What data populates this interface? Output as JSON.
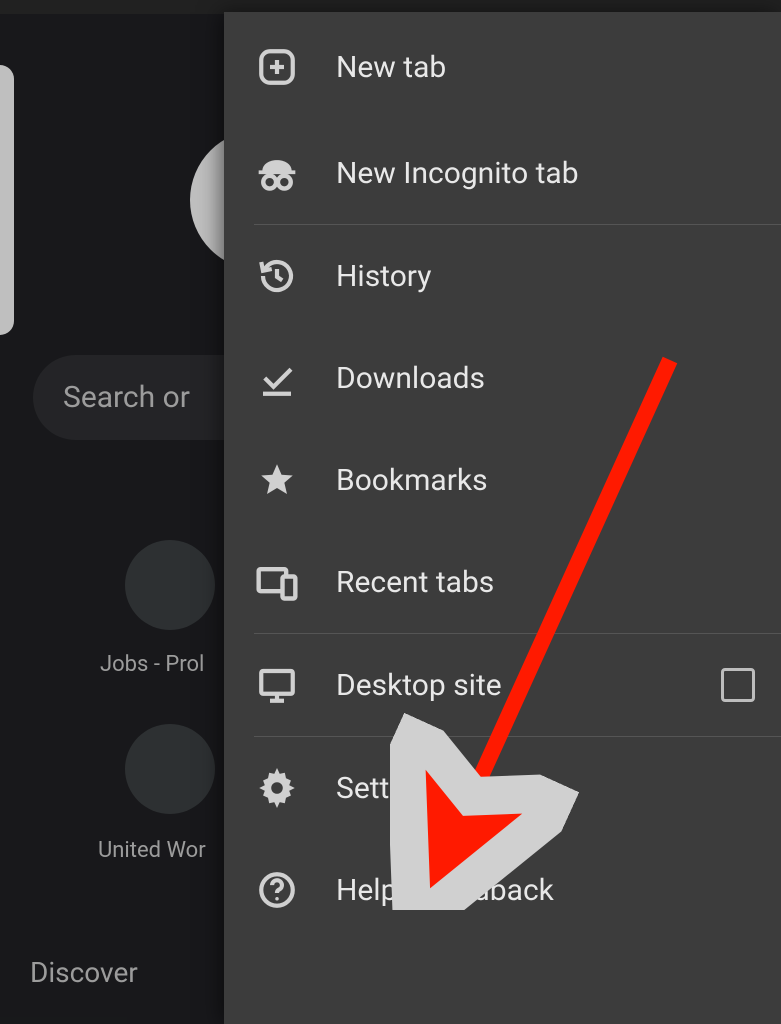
{
  "background": {
    "search_placeholder": "Search or ",
    "tile_labels": [
      "Jobs - Prol",
      "United Wor"
    ],
    "discover": "Discover"
  },
  "menu": {
    "items": [
      {
        "label": "New tab"
      },
      {
        "label": "New Incognito tab"
      },
      {
        "label": "History"
      },
      {
        "label": "Downloads"
      },
      {
        "label": "Bookmarks"
      },
      {
        "label": "Recent tabs"
      },
      {
        "label": "Desktop site"
      },
      {
        "label": "Settings"
      },
      {
        "label": "Help & feedback"
      }
    ]
  }
}
